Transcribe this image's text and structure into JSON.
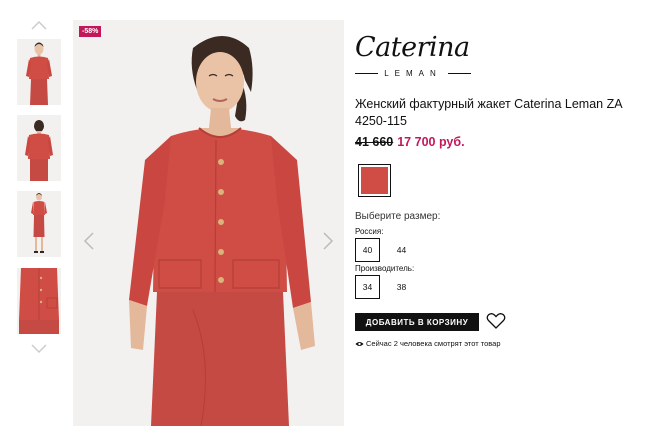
{
  "gallery": {
    "up_icon": "chevron-up-icon",
    "down_icon": "chevron-down-icon",
    "thumbnails": [
      "front-full",
      "back",
      "full-length",
      "detail"
    ]
  },
  "main_image": {
    "discount_badge": "-58%",
    "prev_icon": "chevron-left-icon",
    "next_icon": "chevron-right-icon"
  },
  "brand": {
    "name": "Caterina",
    "sub": "LEMAN"
  },
  "product": {
    "title": "Женский фактурный жакет Caterina Leman ZA 4250-115",
    "price_old": "41 660",
    "price_new": "17 700 руб.",
    "color_swatch": "#cf4d45"
  },
  "sizes": {
    "heading": "Выберите размер:",
    "russia_label": "Россия:",
    "russia_options": [
      "40",
      "44"
    ],
    "maker_label": "Производитель:",
    "maker_options": [
      "34",
      "38"
    ],
    "selected_index": 0
  },
  "actions": {
    "add_to_cart": "ДОБАВИТЬ В КОРЗИНУ",
    "favorite_icon": "heart-icon"
  },
  "viewers": {
    "icon": "eye-icon",
    "text": "Сейчас 2 человека смотрят этот товар"
  },
  "colors": {
    "accent": "#c2185b",
    "garment": "#cf4d45",
    "button": "#111111"
  }
}
